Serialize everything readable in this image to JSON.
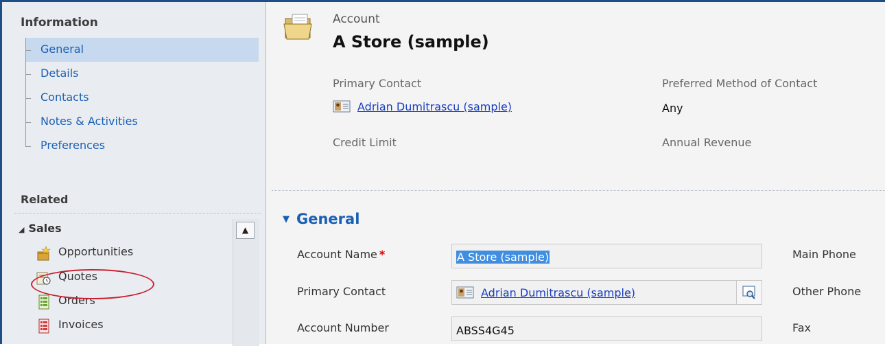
{
  "nav": {
    "information_heading": "Information",
    "information_items": [
      {
        "label": "General",
        "selected": true
      },
      {
        "label": "Details",
        "selected": false
      },
      {
        "label": "Contacts",
        "selected": false
      },
      {
        "label": "Notes & Activities",
        "selected": false
      },
      {
        "label": "Preferences",
        "selected": false
      }
    ],
    "related_heading": "Related",
    "sales_group": "Sales",
    "sales_items": [
      {
        "label": "Opportunities",
        "icon": "opportunities-icon"
      },
      {
        "label": "Quotes",
        "icon": "quotes-icon"
      },
      {
        "label": "Orders",
        "icon": "orders-icon"
      },
      {
        "label": "Invoices",
        "icon": "invoices-icon"
      }
    ]
  },
  "header": {
    "entity_type": "Account",
    "title": "A Store (sample)",
    "primary_contact_label": "Primary Contact",
    "primary_contact_value": "Adrian Dumitrascu (sample)",
    "preferred_method_label": "Preferred Method of Contact",
    "preferred_method_value": "Any",
    "credit_limit_label": "Credit Limit",
    "annual_revenue_label": "Annual Revenue"
  },
  "section": {
    "title": "General",
    "fields": [
      {
        "label": "Account Name",
        "value": "A Store (sample)",
        "required": true
      },
      {
        "label": "Primary Contact",
        "value": "Adrian Dumitrascu (sample)",
        "required": false
      },
      {
        "label": "Account Number",
        "value": "ABSS4G45",
        "required": false
      }
    ],
    "right_labels": [
      "Main Phone",
      "Other Phone",
      "Fax"
    ]
  },
  "colors": {
    "link": "#1a5fb4",
    "selected_nav": "#c6d9ef",
    "highlight_circle": "#cc1f2f",
    "frame": "#1f4e86"
  }
}
